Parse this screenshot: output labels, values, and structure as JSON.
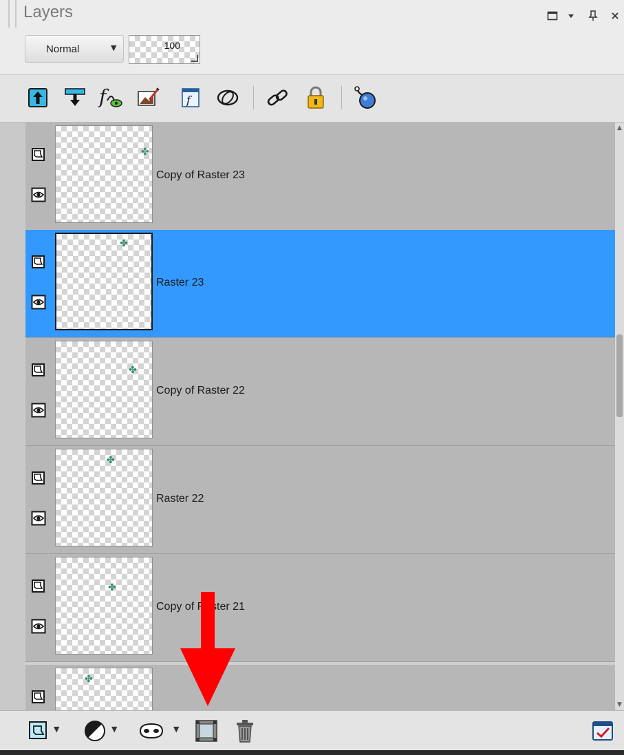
{
  "panel": {
    "title": "Layers",
    "window_controls": {
      "restore_icon": "square-icon",
      "menu_icon": "dropdown-arrow-icon",
      "pin_icon": "pin-icon",
      "close_icon": "close-icon"
    }
  },
  "blend": {
    "mode": "Normal",
    "opacity": "100"
  },
  "toolbar": {
    "buttons": [
      "move-layer-up-icon",
      "move-layer-down-icon",
      "layer-effects-icon",
      "edit-selection-icon",
      "paint-layer-icon",
      "link-mode-icon",
      "link-icon",
      "lock-icon",
      "highlight-icon"
    ]
  },
  "layers": [
    {
      "name": "Copy of Raster 23",
      "selected": false
    },
    {
      "name": "Raster 23",
      "selected": true
    },
    {
      "name": "Copy of Raster 22",
      "selected": false
    },
    {
      "name": "Raster 22",
      "selected": false
    },
    {
      "name": "Copy of Raster 21",
      "selected": false
    },
    {
      "name": "",
      "selected": false
    }
  ],
  "bottom_toolbar": {
    "buttons": [
      "new-layer-icon",
      "adjustment-layer-icon",
      "mask-icon",
      "group-layers-icon",
      "delete-layer-icon",
      "properties-icon"
    ]
  },
  "colors": {
    "selection": "#3399ff",
    "row_background": "#b7b7b7",
    "annotation_arrow": "#ff0000"
  }
}
